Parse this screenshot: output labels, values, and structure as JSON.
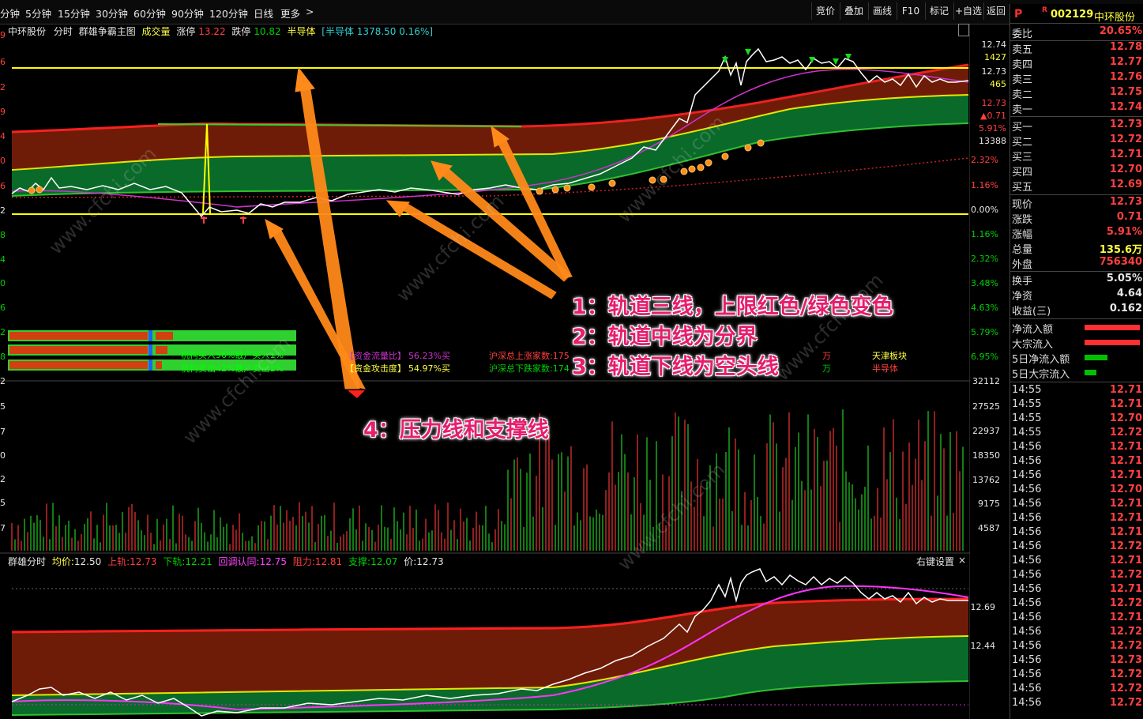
{
  "topbar": {
    "periods": [
      "分钟",
      "5分钟",
      "15分钟",
      "30分钟",
      "60分钟",
      "90分钟",
      "120分钟",
      "日线",
      "更多"
    ],
    "more_arrow": ">",
    "right_buttons": [
      "竞价",
      "叠加",
      "画线",
      "F10",
      "标记",
      "+自选",
      "返回"
    ]
  },
  "header": {
    "stock_name": "中环股份",
    "view": "分时",
    "indicator": "群雄争霸主图",
    "volume_label": "成交量",
    "limit_up_label": "涨停",
    "limit_up_value": "13.22",
    "limit_down_label": "跌停",
    "limit_down_value": "10.82",
    "sector_label": "半导体",
    "sector_index": "[半导体",
    "sector_index_value": "1378.50 0.16%]"
  },
  "price_axis": [
    "12.74",
    "1427",
    "12.73",
    "465",
    "12.73",
    "▲0.71",
    "5.91%",
    "13388",
    "2.32%",
    "1.16%",
    "0.00%",
    "1.16%",
    "2.32%",
    "3.48%",
    "4.63%",
    "5.79%",
    "6.95%"
  ],
  "left_axis": [
    "9",
    "6",
    "2",
    "9",
    "4",
    "0",
    "6",
    "2",
    "8",
    "4",
    "0",
    "6",
    "2",
    "8"
  ],
  "volume_axis": [
    "32112",
    "27525",
    "22937",
    "18350",
    "13762",
    "9175",
    "4587"
  ],
  "volume_left_axis": [
    "2",
    "5",
    "7",
    "0",
    "2",
    "5",
    "7"
  ],
  "lower_axis": [
    "12.69",
    "12.44"
  ],
  "fund_panel": {
    "rows": [
      "机构买入56%散户买入1%",
      "机构卖出42%散户卖出1%"
    ],
    "flow_ratio_label": "【资金流量比】",
    "flow_ratio_value": "56.23%买",
    "attack_label": "【资金攻击度】",
    "attack_value": "54.97%买",
    "up_count": "沪深总上涨家数:175",
    "down_count": "沪深总下跌家数:174",
    "wan1": "万",
    "wan2": "万",
    "sector1": "天津板块",
    "sector2": "半导体"
  },
  "lower_header": {
    "name": "群雄分时",
    "avg_label": "均价:",
    "avg": "12.50",
    "upper_label": "上轨:",
    "upper": "12.73",
    "lower_label": "下轨:",
    "lower": "12.21",
    "confirm_label": "回调认同:",
    "confirm": "12.75",
    "resist_label": "阻力:",
    "resist": "12.81",
    "support_label": "支撑:",
    "support": "12.07",
    "price_label": "价:",
    "price": "12.73",
    "settings": "右键设置",
    "close": "×"
  },
  "annotations": [
    "1：轨道三线，上限红色/绿色变色",
    "2：轨道中线为分界",
    "3：轨道下线为空头线",
    "4：压力线和支撑线"
  ],
  "watermark": "www.cfchi.com",
  "right_panel": {
    "p_icon": "P",
    "r_icon": "R",
    "code": "002129",
    "name": "中环股份",
    "weibi_label": "委比",
    "weibi": "20.65%",
    "asks": [
      {
        "label": "卖五",
        "price": "12.78"
      },
      {
        "label": "卖四",
        "price": "12.77"
      },
      {
        "label": "卖三",
        "price": "12.76"
      },
      {
        "label": "卖二",
        "price": "12.75"
      },
      {
        "label": "卖一",
        "price": "12.74"
      }
    ],
    "bids": [
      {
        "label": "买一",
        "price": "12.73"
      },
      {
        "label": "买二",
        "price": "12.72"
      },
      {
        "label": "买三",
        "price": "12.71"
      },
      {
        "label": "买四",
        "price": "12.70"
      },
      {
        "label": "买五",
        "price": "12.69"
      }
    ],
    "stats": [
      {
        "label": "现价",
        "value": "12.73",
        "color": "#ff4040"
      },
      {
        "label": "涨跌",
        "value": "0.71",
        "color": "#ff4040"
      },
      {
        "label": "涨幅",
        "value": "5.91%",
        "color": "#ff4040"
      },
      {
        "label": "总量",
        "value": "135.6万",
        "color": "#ffff40"
      },
      {
        "label": "外盘",
        "value": "756340",
        "color": "#ff4040"
      }
    ],
    "stats2": [
      {
        "label": "换手",
        "value": "5.05%",
        "color": "#e6e6e6"
      },
      {
        "label": "净资",
        "value": "4.64",
        "color": "#e6e6e6"
      },
      {
        "label": "收益(三)",
        "value": "0.162",
        "color": "#e6e6e6"
      }
    ],
    "flows": [
      {
        "label": "净流入额",
        "color": "#ff3030",
        "fraction": 1.0
      },
      {
        "label": "大宗流入",
        "color": "#ff3030",
        "fraction": 1.0
      },
      {
        "label": "5日净流入额",
        "color": "#00c000",
        "fraction": 0.41
      },
      {
        "label": "5日大宗流入",
        "color": "#00c000",
        "fraction": 0.21
      }
    ],
    "ticks": [
      {
        "time": "14:55",
        "price": "12.71"
      },
      {
        "time": "14:55",
        "price": "12.71"
      },
      {
        "time": "14:55",
        "price": "12.70"
      },
      {
        "time": "14:55",
        "price": "12.72"
      },
      {
        "time": "14:56",
        "price": "12.71"
      },
      {
        "time": "14:56",
        "price": "12.71"
      },
      {
        "time": "14:56",
        "price": "12.71"
      },
      {
        "time": "14:56",
        "price": "12.70"
      },
      {
        "time": "14:56",
        "price": "12.71"
      },
      {
        "time": "14:56",
        "price": "12.71"
      },
      {
        "time": "14:56",
        "price": "12.71"
      },
      {
        "time": "14:56",
        "price": "12.72"
      },
      {
        "time": "14:56",
        "price": "12.71"
      },
      {
        "time": "14:56",
        "price": "12.72"
      },
      {
        "time": "14:56",
        "price": "12.71"
      },
      {
        "time": "14:56",
        "price": "12.72"
      },
      {
        "time": "14:56",
        "price": "12.71"
      },
      {
        "time": "14:56",
        "price": "12.72"
      },
      {
        "time": "14:56",
        "price": "12.72"
      },
      {
        "time": "14:56",
        "price": "12.73"
      },
      {
        "time": "14:56",
        "price": "12.72"
      },
      {
        "time": "14:56",
        "price": "12.72"
      },
      {
        "time": "14:56",
        "price": "12.72"
      }
    ]
  },
  "colors": {
    "up": "#ff4040",
    "down": "#00d000",
    "band_upper": "#7a1f0a",
    "band_lower": "#0a6a2a",
    "price_line": "#ffffff",
    "avg_line": "#cc33cc",
    "yellow_line": "#ffff00",
    "arrow": "#ff8a1a",
    "annotation": "#e61e6e"
  }
}
